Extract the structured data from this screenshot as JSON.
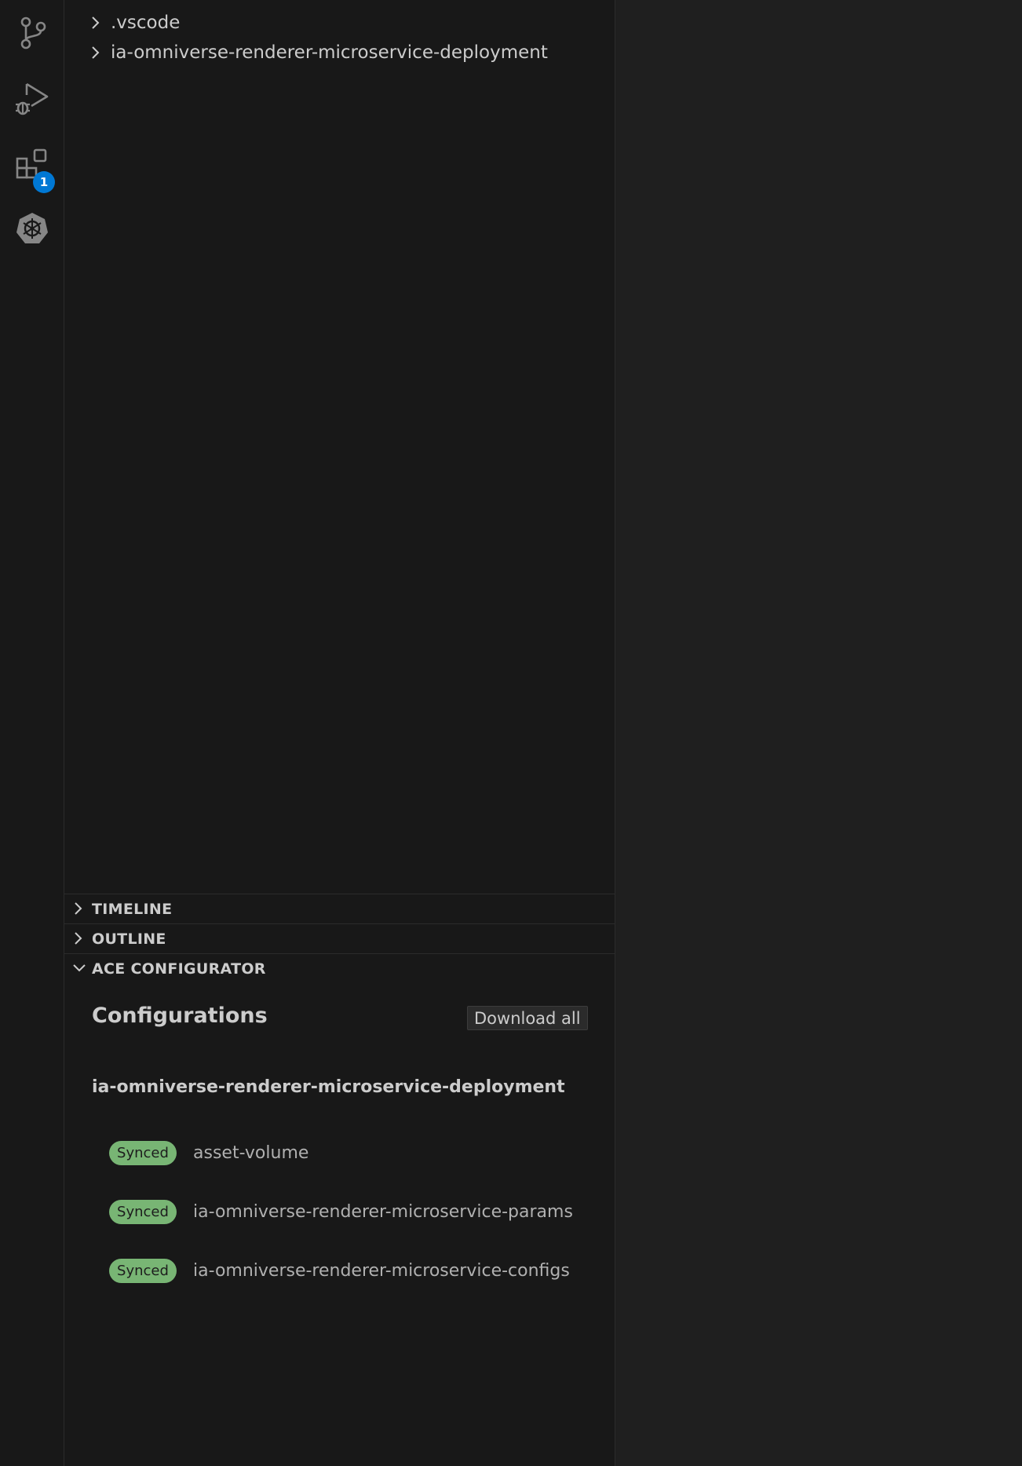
{
  "activity_bar": {
    "items": [
      {
        "icon": "source-control-icon"
      },
      {
        "icon": "run-debug-icon"
      },
      {
        "icon": "extensions-icon",
        "badge": "1"
      },
      {
        "icon": "kubernetes-icon"
      }
    ],
    "badge_color": "#0078d4"
  },
  "explorer": {
    "items": [
      {
        "label": ".vscode",
        "icon": "chevron-right-icon"
      },
      {
        "label": "ia-omniverse-renderer-microservice-deployment",
        "icon": "chevron-right-icon"
      }
    ]
  },
  "sections": {
    "timeline": {
      "title": "TIMELINE",
      "icon": "chevron-right-icon"
    },
    "outline": {
      "title": "OUTLINE",
      "icon": "chevron-right-icon"
    },
    "ace": {
      "title": "ACE CONFIGURATOR",
      "icon": "chevron-down-icon"
    }
  },
  "ace_panel": {
    "title": "Configurations",
    "download_label": "Download all",
    "group": "ia-omniverse-renderer-microservice-deployment",
    "configs": [
      {
        "status": "Synced",
        "name": "asset-volume"
      },
      {
        "status": "Synced",
        "name": "ia-omniverse-renderer-microservice-params"
      },
      {
        "status": "Synced",
        "name": "ia-omniverse-renderer-microservice-configs"
      }
    ],
    "status_color": "#89d185"
  }
}
